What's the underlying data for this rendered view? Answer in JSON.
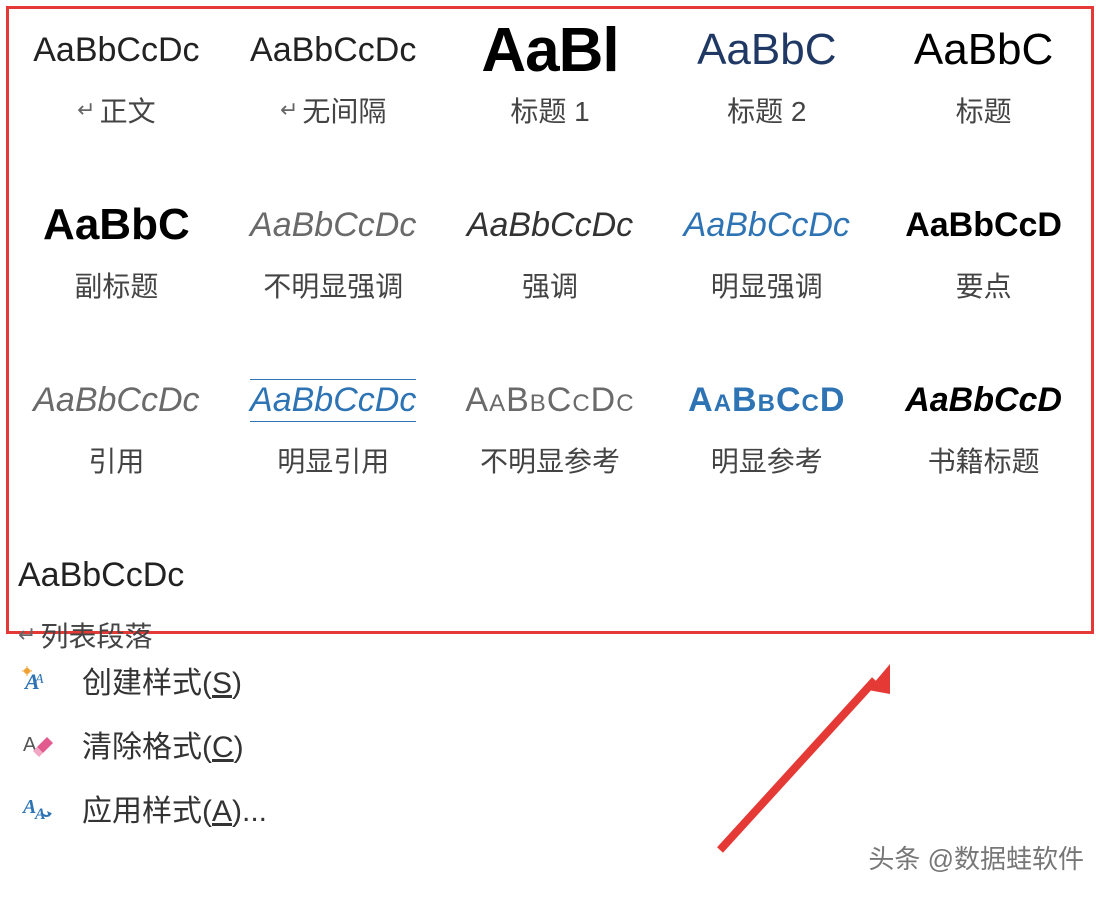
{
  "styles": [
    {
      "preview": "AaBbCcDc",
      "cls": "p-normal",
      "name": "正文",
      "mark": true
    },
    {
      "preview": "AaBbCcDc",
      "cls": "p-normal",
      "name": "无间隔",
      "mark": true
    },
    {
      "preview": "AaBl",
      "cls": "p-h1",
      "name": "标题 1",
      "mark": false
    },
    {
      "preview": "AaBbC",
      "cls": "p-h2",
      "name": "标题 2",
      "mark": false
    },
    {
      "preview": "AaBbC",
      "cls": "p-title",
      "name": "标题",
      "mark": false
    },
    {
      "preview": "AaBbC",
      "cls": "p-subtitle",
      "name": "副标题",
      "mark": false
    },
    {
      "preview": "AaBbCcDc",
      "cls": "p-subtle-em",
      "name": "不明显强调",
      "mark": false
    },
    {
      "preview": "AaBbCcDc",
      "cls": "p-emph",
      "name": "强调",
      "mark": false
    },
    {
      "preview": "AaBbCcDc",
      "cls": "p-intense-em",
      "name": "明显强调",
      "mark": false
    },
    {
      "preview": "AaBbCcD",
      "cls": "p-strong",
      "name": "要点",
      "mark": false
    },
    {
      "preview": "AaBbCcDc",
      "cls": "p-quote",
      "name": "引用",
      "mark": false
    },
    {
      "preview": "AaBbCcDc",
      "cls": "p-iquote",
      "name": "明显引用",
      "mark": false
    },
    {
      "preview": "AaBbCcDc",
      "cls": "p-subtle-ref",
      "name": "不明显参考",
      "mark": false
    },
    {
      "preview": "AaBbCcD",
      "cls": "p-intense-ref",
      "name": "明显参考",
      "mark": false
    },
    {
      "preview": "AaBbCcD",
      "cls": "p-book",
      "name": "书籍标题",
      "mark": false
    },
    {
      "preview": "AaBbCcDc",
      "cls": "p-list",
      "name": "列表段落",
      "mark": true,
      "lastrow": true
    }
  ],
  "menu": {
    "create_prefix": "创建样式(",
    "create_key": "S",
    "create_suffix": ")",
    "clear_prefix": "清除格式(",
    "clear_key": "C",
    "clear_suffix": ")",
    "apply_prefix": "应用样式(",
    "apply_key": "A",
    "apply_suffix": ")..."
  },
  "watermark": "头条 @数据蛙软件",
  "para_mark_glyph": "↵"
}
